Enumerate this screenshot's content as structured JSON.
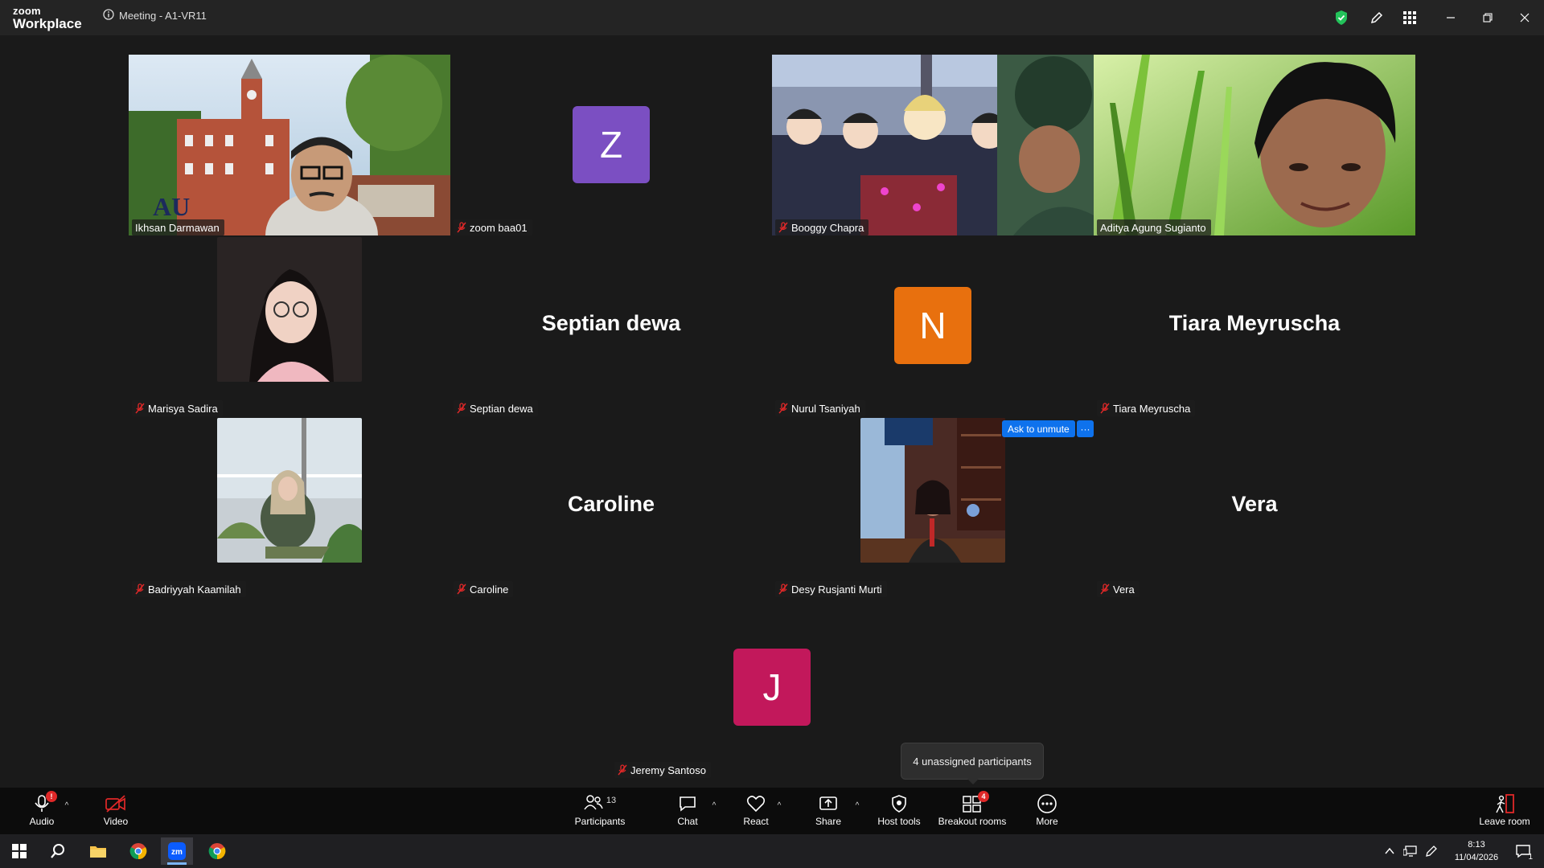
{
  "window": {
    "brand_top": "zoom",
    "brand_bottom": "Workplace",
    "meeting_title": "Meeting - A1-VR11"
  },
  "tiles": [
    {
      "id": "ihsan",
      "name": "Ikhsan Darmawan",
      "type": "video",
      "muted": false
    },
    {
      "id": "zoom-baa01",
      "name": "zoom baa01",
      "type": "avatar",
      "letter": "Z",
      "color": "#7b4fc2",
      "muted": true
    },
    {
      "id": "booggy",
      "name": "Booggy Chapra",
      "type": "video",
      "muted": true
    },
    {
      "id": "aditya",
      "name": "Aditya Agung Sugianto",
      "type": "video",
      "muted": false,
      "speaking": true
    },
    {
      "id": "marisya",
      "name": "Marisya Sadira",
      "type": "photo",
      "muted": true
    },
    {
      "id": "septian",
      "name": "Septian dewa",
      "type": "name",
      "display": "Septian dewa",
      "muted": true
    },
    {
      "id": "nurul",
      "name": "Nurul Tsaniyah",
      "type": "avatar",
      "letter": "N",
      "color": "#e8700e",
      "muted": true
    },
    {
      "id": "tiara",
      "name": "Tiara Meyruscha",
      "type": "name",
      "display": "Tiara Meyruscha",
      "muted": true
    },
    {
      "id": "badriyyah",
      "name": "Badriyyah Kaamilah",
      "type": "photo",
      "muted": true
    },
    {
      "id": "caroline",
      "name": "Caroline",
      "type": "name",
      "display": "Caroline",
      "muted": true
    },
    {
      "id": "desy",
      "name": "Desy Rusjanti Murti",
      "type": "photo",
      "muted": true
    },
    {
      "id": "vera",
      "name": "Vera",
      "type": "name",
      "display": "Vera",
      "muted": true
    },
    {
      "id": "jeremy",
      "name": "Jeremy Santoso",
      "type": "avatar",
      "letter": "J",
      "color": "#c2185b",
      "muted": true
    }
  ],
  "hover_actions": {
    "ask_to_unmute": "Ask to unmute",
    "more": "···"
  },
  "tooltip": {
    "breakout": "4 unassigned participants"
  },
  "toolbar": {
    "audio": "Audio",
    "audio_badge": "!",
    "video": "Video",
    "participants": "Participants",
    "participants_count": "13",
    "chat": "Chat",
    "react": "React",
    "share": "Share",
    "host_tools": "Host tools",
    "breakout_rooms": "Breakout rooms",
    "breakout_badge": "4",
    "more": "More",
    "leave": "Leave room"
  },
  "taskbar": {
    "time": "8:13",
    "date": "11/04/2026",
    "notif_count": "1"
  },
  "colors": {
    "speaking_border": "#23d18b",
    "mute_red": "#e02828",
    "accent_blue": "#0e72ed"
  }
}
